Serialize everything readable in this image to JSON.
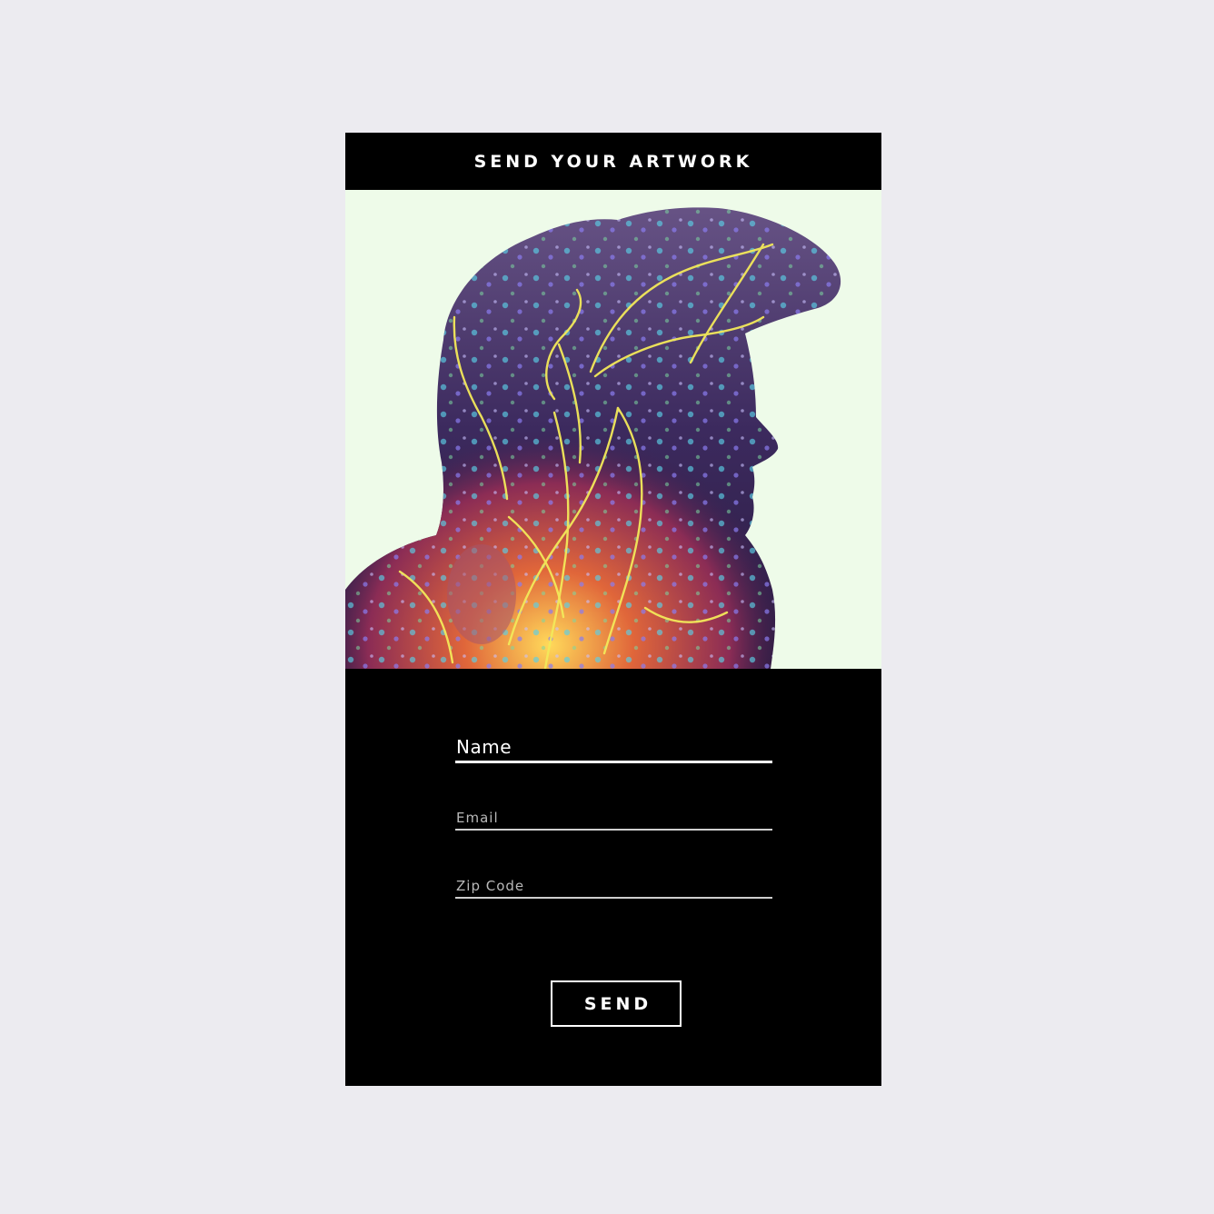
{
  "header": {
    "title": "SEND YOUR ARTWORK"
  },
  "artwork": {
    "icon": "profile-silhouette-artwork",
    "background": "#eefbe9"
  },
  "form": {
    "name_label": "Name",
    "email_label": "Email",
    "zip_label": "Zip Code",
    "send_label": "SEND"
  },
  "colors": {
    "page_bg": "#ecebf0",
    "card_bg": "#000000",
    "accent_glow": "#f3e95a"
  }
}
